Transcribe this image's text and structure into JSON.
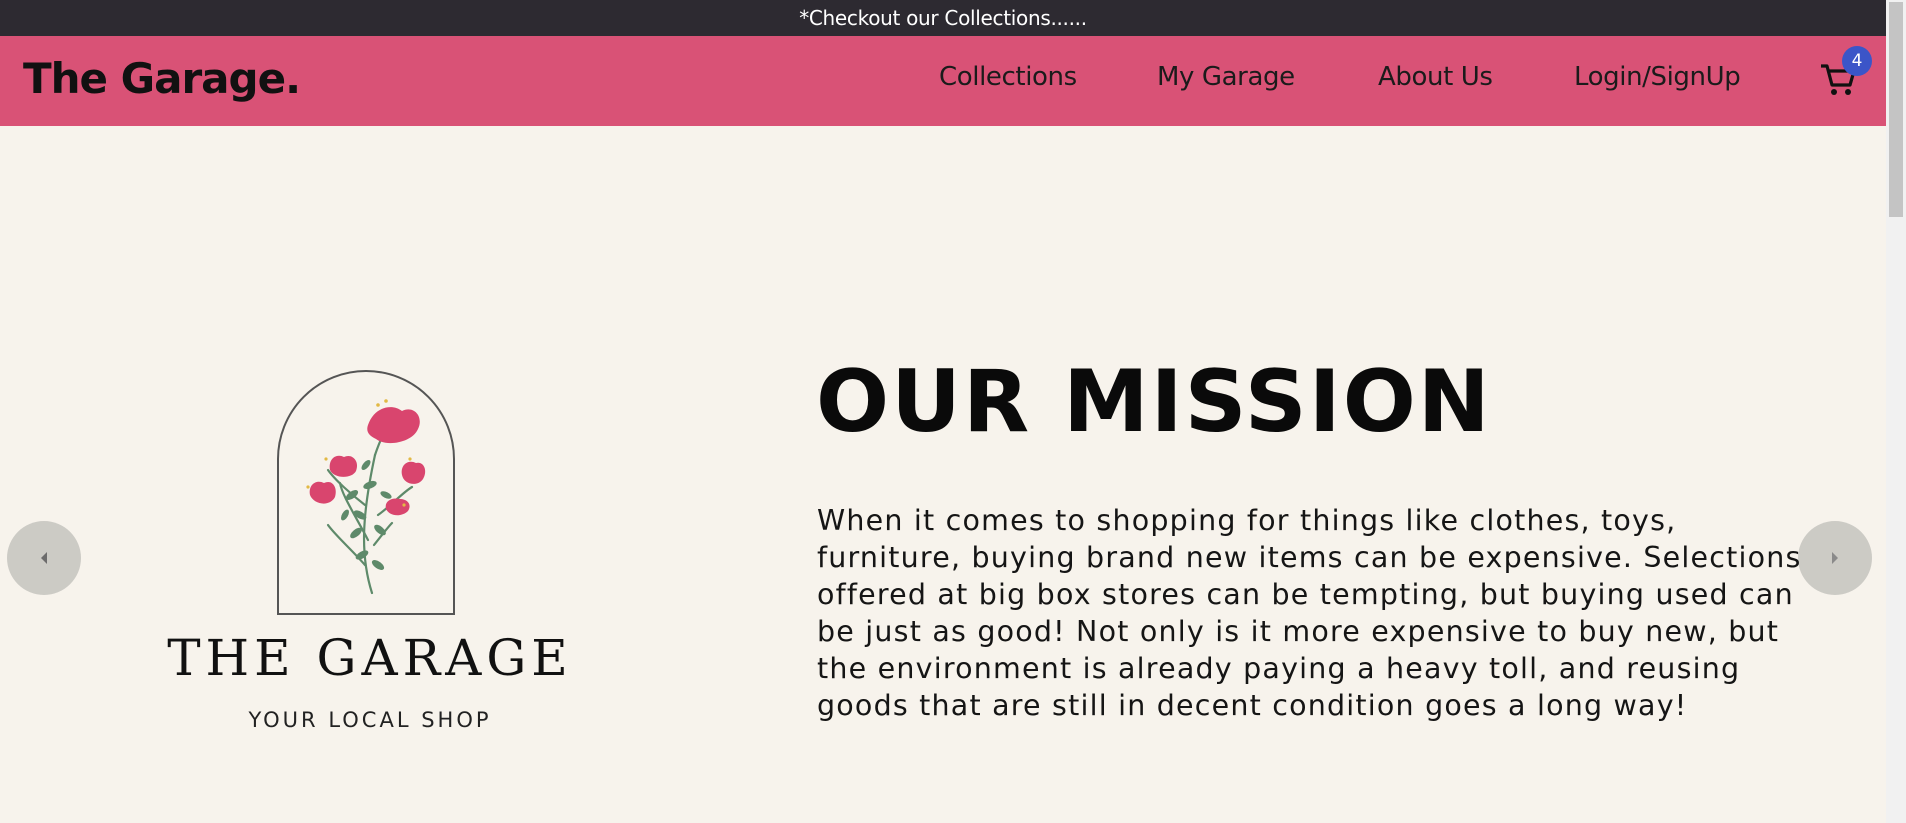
{
  "announcement": "*Checkout our Collections......",
  "brand": "The Garage.",
  "nav": [
    {
      "label": "Collections"
    },
    {
      "label": "My Garage"
    },
    {
      "label": "About Us"
    },
    {
      "label": "Login/SignUp"
    }
  ],
  "cart": {
    "icon": "cart-icon",
    "count": "4"
  },
  "logo": {
    "title": "THE GARAGE",
    "tagline": "YOUR LOCAL SHOP"
  },
  "mission": {
    "title": "OUR MISSION",
    "body": "When it comes to shopping for things like clothes, toys, furniture, buying brand new items can be expensive. Selections offered at big box stores can be tempting, but buying used can be just as good! Not only is it more expensive to buy new, but the environment is already paying a heavy toll, and reusing goods that are still in decent condition goes a long way!"
  },
  "carousel": {
    "prev_icon": "caret-left-icon",
    "next_icon": "caret-right-icon"
  },
  "colors": {
    "announcement_bg": "#2d2a31",
    "nav_bg": "#d95276",
    "page_bg": "#f7f3ec",
    "badge": "#3b55c8",
    "flower": "#d9456e",
    "leaf": "#5e8a6a"
  }
}
